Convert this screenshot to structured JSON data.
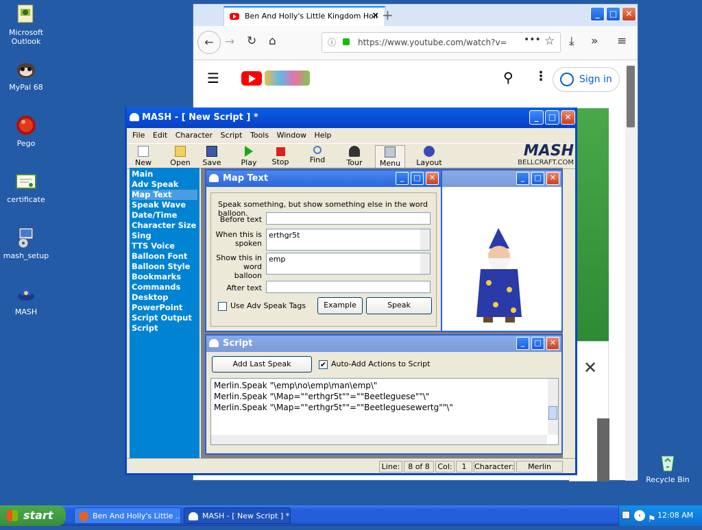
{
  "desktop": {
    "icons": [
      {
        "label": "Microsoft\nOutlook",
        "icon": "outlook-icon"
      },
      {
        "label": "MyPal 68",
        "icon": "mypal-icon"
      },
      {
        "label": "Pego",
        "icon": "pego-icon"
      },
      {
        "label": "certificate",
        "icon": "certificate-icon"
      },
      {
        "label": "mash_setup",
        "icon": "installer-icon"
      },
      {
        "label": "MASH",
        "icon": "mash-icon"
      },
      {
        "label": "Recycle Bin",
        "icon": "recycle-bin-icon"
      }
    ]
  },
  "browser": {
    "tab_title": "Ben And Holly's Little Kingdom Holl",
    "url": "https://www.youtube.com/watch?v=",
    "sign_in": "Sign in"
  },
  "mash": {
    "title": "MASH - [ New Script ] *",
    "menu": [
      "File",
      "Edit",
      "Character",
      "Script",
      "Tools",
      "Window",
      "Help"
    ],
    "toolbar": [
      "New",
      "Open",
      "Save",
      "Play",
      "Stop",
      "Find",
      "Tour",
      "Menu",
      "Layout"
    ],
    "brand": "MASH",
    "brand_url": "BELLCRAFT.COM",
    "sidebar": [
      "Main",
      "Adv Speak",
      "Map Text",
      "Speak Wave",
      "Date/Time",
      "Character Size",
      "Sing",
      "TTS Voice",
      "Balloon Font",
      "Balloon Style",
      "Bookmarks",
      "Commands",
      "Desktop",
      "PowerPoint",
      "Script Output",
      "Script"
    ],
    "sidebar_selected": "Map Text",
    "maptext": {
      "title": "Map Text",
      "description": "Speak something, but show something else in the word balloon.",
      "before_label": "Before text",
      "before_value": "",
      "when_label": "When this is spoken",
      "when_value": "erthgr5t",
      "show_label": "Show this in word balloon",
      "show_value": "emp",
      "after_label": "After text",
      "after_value": "",
      "use_adv_label": "Use Adv Speak Tags",
      "example_btn": "Example",
      "speak_btn": "Speak"
    },
    "script": {
      "title": "Script",
      "add_last_btn": "Add Last Speak",
      "auto_add_label": "Auto-Add Actions to Script",
      "lines": [
        "Merlin.Speak \"\\emp\\no\\emp\\man\\emp\\\"",
        "Merlin.Speak \"\\Map=\"\"erthgr5t\"\"=\"\"Beetleguese\"\"\\\"",
        "Merlin.Speak \"\\Map=\"\"erthgr5t\"\"=\"\"Beetleguesewertg\"\"\\\""
      ]
    },
    "status": {
      "line_label": "Line:",
      "line_value": "8 of 8",
      "col_label": "Col:",
      "col_value": "1",
      "char_label": "Character:",
      "char_value": "Merlin"
    }
  },
  "taskbar": {
    "start": "start",
    "tasks": [
      "Ben And Holly's Little ...",
      "MASH - [ New Script ] *"
    ],
    "clock": "12:08 AM"
  }
}
